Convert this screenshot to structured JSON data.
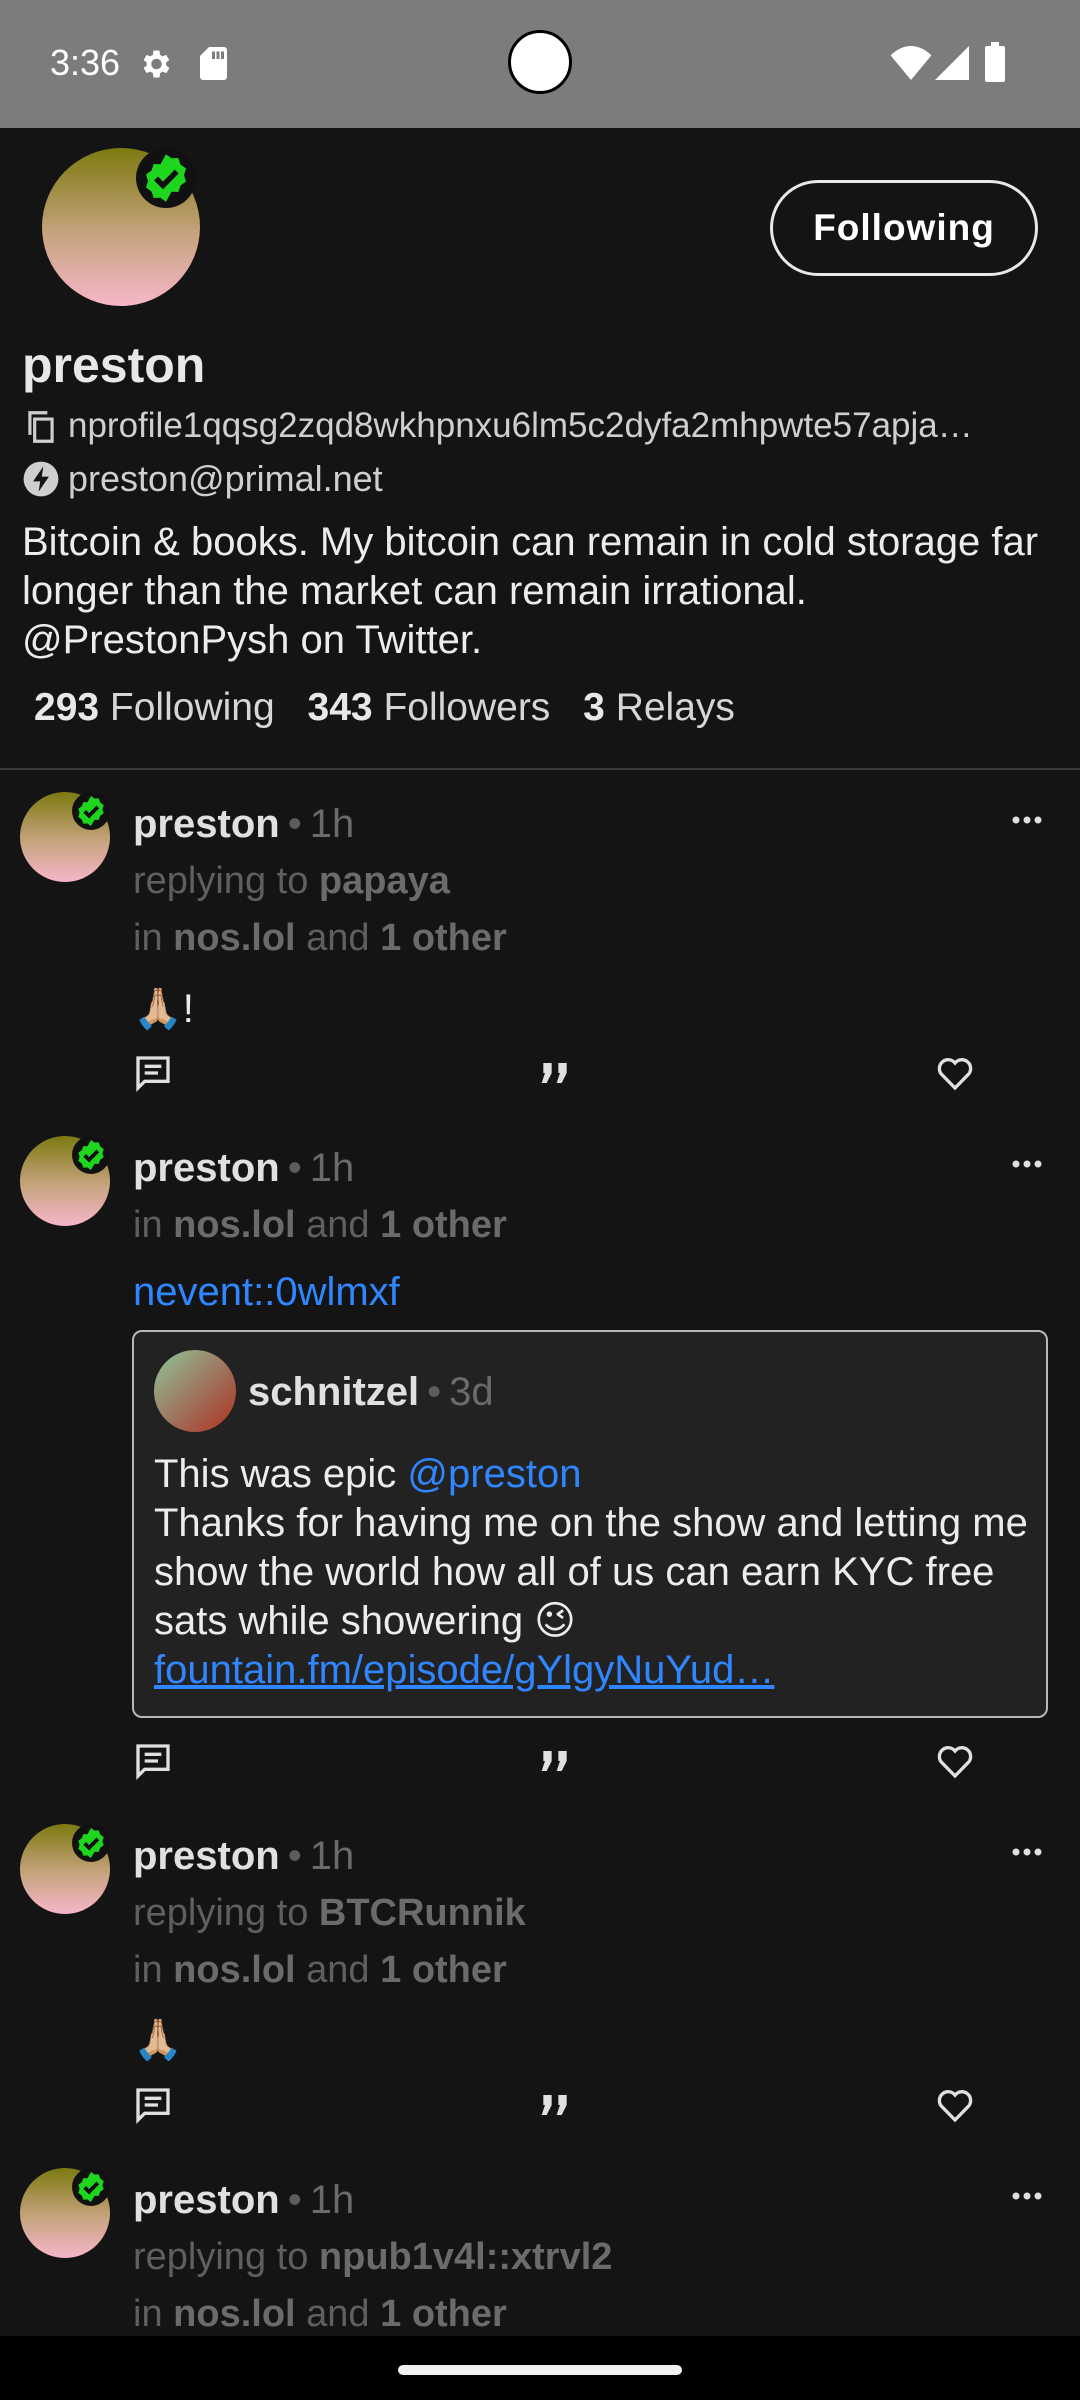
{
  "status_bar": {
    "time": "3:36",
    "icons": [
      "gear-icon",
      "sd-card-icon",
      "wifi-icon",
      "signal-icon",
      "battery-icon"
    ]
  },
  "profile": {
    "name": "preston",
    "npub": "nprofile1qqsg2zqd8wkhpnxu6lm5c2dyfa2mhpwte57apja…",
    "nip05": "preston@primal.net",
    "bio": "Bitcoin & books. My bitcoin can remain in cold storage far longer than the market can remain irrational. @PrestonPysh on Twitter.",
    "follow_button": "Following",
    "stats": {
      "following_count": "293",
      "following_label": "Following",
      "followers_count": "343",
      "followers_label": "Followers",
      "relays_count": "3",
      "relays_label": "Relays"
    },
    "verified_color": "#1fd61f"
  },
  "posts": [
    {
      "author": "preston",
      "dot": "•",
      "time": "1h",
      "reply_prefix": "replying to",
      "reply_to": "papaya",
      "in_prefix": "in",
      "relay": "nos.lol",
      "and_text": "and",
      "others": "1 other",
      "content": "🙏🏼!"
    },
    {
      "author": "preston",
      "dot": "•",
      "time": "1h",
      "in_prefix": "in",
      "relay": "nos.lol",
      "and_text": "and",
      "others": "1 other",
      "link": "nevent::0wlmxf",
      "quote": {
        "author": "schnitzel",
        "dot": "•",
        "time": "3d",
        "line1": "This was epic ",
        "mention": "@preston",
        "body": "Thanks for having me on the show and letting me show the world how all of us can earn KYC free sats while showering 😉",
        "url": "fountain.fm/episode/gYlgyNuYud…"
      }
    },
    {
      "author": "preston",
      "dot": "•",
      "time": "1h",
      "reply_prefix": "replying to",
      "reply_to": "BTCRunnik",
      "in_prefix": "in",
      "relay": "nos.lol",
      "and_text": "and",
      "others": "1 other",
      "content": "🙏🏼"
    },
    {
      "author": "preston",
      "dot": "•",
      "time": "1h",
      "reply_prefix": "replying to",
      "reply_to": "npub1v4l::xtrvl2",
      "in_prefix": "in",
      "relay": "nos.lol",
      "and_text": "and",
      "others": "1 other"
    }
  ],
  "post_actions": [
    "reply-icon",
    "quote-icon",
    "like-icon"
  ],
  "colors": {
    "background": "#141414",
    "link": "#2f86ff",
    "muted": "#6b6b6b"
  }
}
